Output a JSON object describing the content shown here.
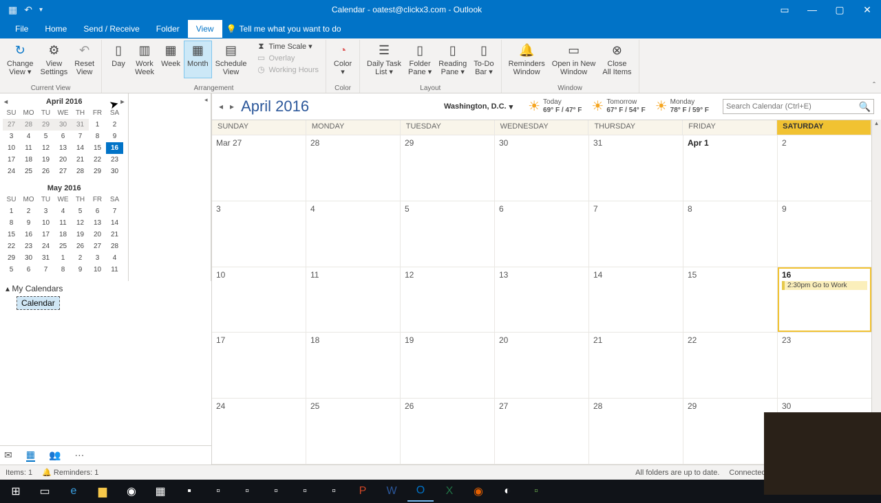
{
  "window_title": "Calendar - oatest@clickx3.com - Outlook",
  "menu": {
    "file": "File",
    "home": "Home",
    "sendreceive": "Send / Receive",
    "folder": "Folder",
    "view": "View",
    "tellme": "Tell me what you want to do"
  },
  "ribbon": {
    "change_view": "Change\nView ▾",
    "view_settings": "View\nSettings",
    "reset_view": "Reset\nView",
    "current_view": "Current View",
    "day": "Day",
    "work_week": "Work\nWeek",
    "week": "Week",
    "month": "Month",
    "schedule_view": "Schedule\nView",
    "time_scale": "Time Scale ▾",
    "overlay": "Overlay",
    "working_hours": "Working Hours",
    "arrangement": "Arrangement",
    "color": "Color\n▾",
    "color_group": "Color",
    "daily_task": "Daily Task\nList ▾",
    "folder_pane": "Folder\nPane ▾",
    "reading_pane": "Reading\nPane ▾",
    "todo_bar": "To-Do\nBar ▾",
    "layout": "Layout",
    "reminders": "Reminders\nWindow",
    "open_new": "Open in New\nWindow",
    "close_all": "Close\nAll Items",
    "window": "Window"
  },
  "mini1": {
    "title": "April 2016",
    "dh": [
      "SU",
      "MO",
      "TU",
      "WE",
      "TH",
      "FR",
      "SA"
    ],
    "rows": [
      [
        "27",
        "28",
        "29",
        "30",
        "31",
        "1",
        "2"
      ],
      [
        "3",
        "4",
        "5",
        "6",
        "7",
        "8",
        "9"
      ],
      [
        "10",
        "11",
        "12",
        "13",
        "14",
        "15",
        "16"
      ],
      [
        "17",
        "18",
        "19",
        "20",
        "21",
        "22",
        "23"
      ],
      [
        "24",
        "25",
        "26",
        "27",
        "28",
        "29",
        "30"
      ]
    ]
  },
  "mini2": {
    "title": "May 2016",
    "rows": [
      [
        "1",
        "2",
        "3",
        "4",
        "5",
        "6",
        "7"
      ],
      [
        "8",
        "9",
        "10",
        "11",
        "12",
        "13",
        "14"
      ],
      [
        "15",
        "16",
        "17",
        "18",
        "19",
        "20",
        "21"
      ],
      [
        "22",
        "23",
        "24",
        "25",
        "26",
        "27",
        "28"
      ],
      [
        "29",
        "30",
        "31",
        "1",
        "2",
        "3",
        "4"
      ],
      [
        "5",
        "6",
        "7",
        "8",
        "9",
        "10",
        "11"
      ]
    ]
  },
  "my_calendars": "My Calendars",
  "calendar_item": "Calendar",
  "main_title": "April 2016",
  "location": "Washington,  D.C.",
  "weather": [
    {
      "label": "Today",
      "temp": "69° F / 47° F"
    },
    {
      "label": "Tomorrow",
      "temp": "67° F / 54° F"
    },
    {
      "label": "Monday",
      "temp": "78° F / 59° F"
    }
  ],
  "search_placeholder": "Search Calendar (Ctrl+E)",
  "day_headers": [
    "SUNDAY",
    "MONDAY",
    "TUESDAY",
    "WEDNESDAY",
    "THURSDAY",
    "FRIDAY",
    "SATURDAY"
  ],
  "weeks": [
    [
      "Mar 27",
      "28",
      "29",
      "30",
      "31",
      "Apr 1",
      "2"
    ],
    [
      "3",
      "4",
      "5",
      "6",
      "7",
      "8",
      "9"
    ],
    [
      "10",
      "11",
      "12",
      "13",
      "14",
      "15",
      "16"
    ],
    [
      "17",
      "18",
      "19",
      "20",
      "21",
      "22",
      "23"
    ],
    [
      "24",
      "25",
      "26",
      "27",
      "28",
      "29",
      "30"
    ]
  ],
  "event": "2:30pm Go to Work",
  "status": {
    "items": "Items: 1",
    "reminders": "Reminders: 1",
    "folders": "All folders are up to date.",
    "connected": "Connected to: Microsoft Exchange"
  }
}
